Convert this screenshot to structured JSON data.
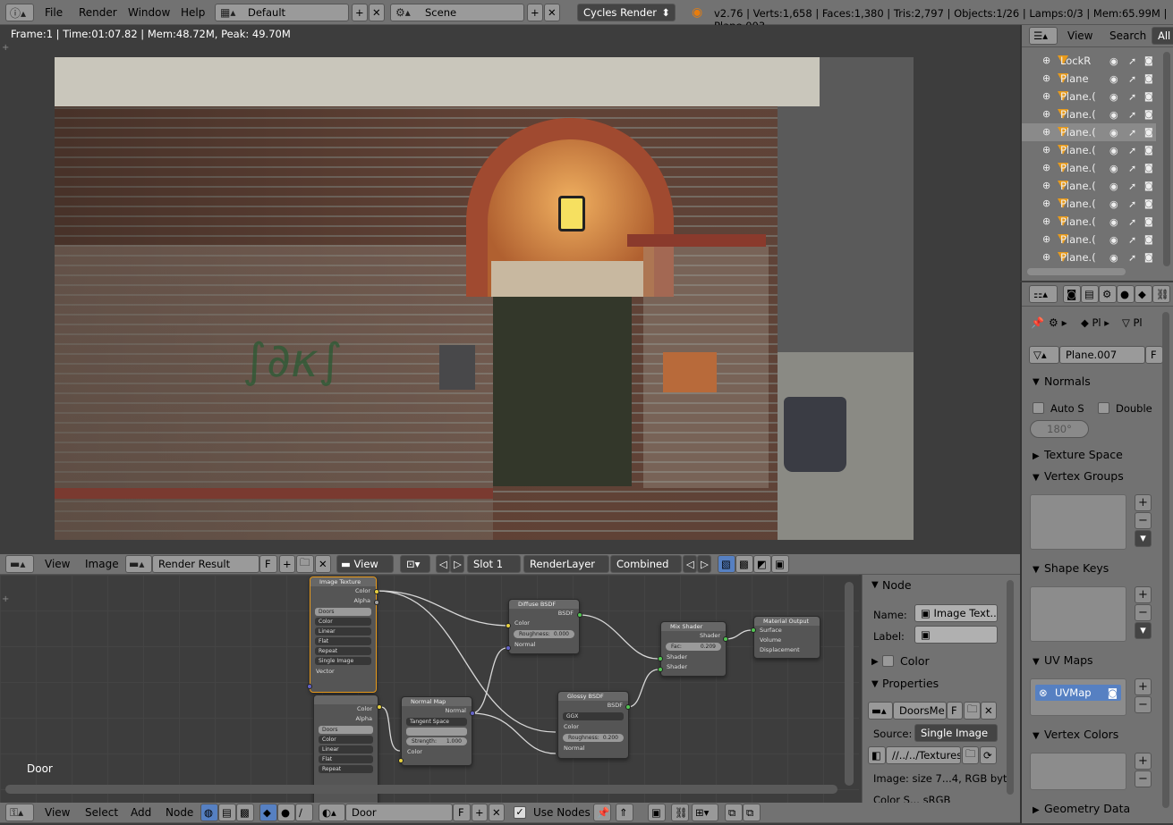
{
  "topbar": {
    "menus": [
      "File",
      "Render",
      "Window",
      "Help"
    ],
    "layout": "Default",
    "scene": "Scene",
    "engine": "Cycles Render",
    "stats": "v2.76 | Verts:1,658 | Faces:1,380 | Tris:2,797 | Objects:1/26 | Lamps:0/3 | Mem:65.99M | Plane.003"
  },
  "render_view": {
    "status": "Frame:1 | Time:01:07.82 | Mem:48.72M, Peak: 49.70M",
    "image_header": {
      "menus": [
        "View",
        "Image"
      ],
      "image_name": "Render Result",
      "f_label": "F",
      "view_label": "View",
      "slot": "Slot 1",
      "layer": "RenderLayer",
      "pass": "Combined"
    }
  },
  "outliner": {
    "header": {
      "view": "View",
      "search": "Search",
      "filter": "All"
    },
    "rows": [
      "LockR",
      "Plane",
      "Plane.(",
      "Plane.(",
      "Plane.(",
      "Plane.(",
      "Plane.(",
      "Plane.(",
      "Plane.(",
      "Plane.(",
      "Plane.(",
      "Plane.("
    ]
  },
  "properties": {
    "breadcrumb": [
      "Pl",
      "Pl"
    ],
    "mesh_name": "Plane.007",
    "f_label": "F",
    "normals": {
      "title": "Normals",
      "auto_smooth": "Auto S",
      "double_sided": "Double",
      "angle": "180°"
    },
    "panels": [
      "Texture Space",
      "Vertex Groups",
      "Shape Keys",
      "UV Maps",
      "Vertex Colors",
      "Geometry Data"
    ],
    "uv_map": "UVMap"
  },
  "node_sidebar": {
    "node_title": "Node",
    "name_label": "Name:",
    "name_value": "Image Text...",
    "label_label": "Label:",
    "color_title": "Color",
    "properties_title": "Properties",
    "image_name": "DoorsMe",
    "f_label": "F",
    "source_label": "Source:",
    "source_value": "Single Image",
    "filepath": "//../../Textures...",
    "image_info": "Image: size 7...4, RGB byte",
    "color_space": "Color S... sRGB"
  },
  "node_editor": {
    "material_label": "Door",
    "header": {
      "menus": [
        "View",
        "Select",
        "Add",
        "Node"
      ],
      "material": "Door",
      "f_label": "F",
      "use_nodes": "Use Nodes"
    },
    "nodes": {
      "image_texture": {
        "title": "Image Texture",
        "outputs": [
          "Color",
          "Alpha"
        ],
        "image": "Doors",
        "dropdowns": [
          "Color",
          "Linear",
          "Flat",
          "Repeat",
          "Single Image"
        ],
        "input": "Vector"
      },
      "image_texture2": {
        "outputs": [
          "Color",
          "Alpha"
        ],
        "image": "Doors",
        "dropdowns": [
          "Color",
          "Linear",
          "Flat",
          "Repeat"
        ]
      },
      "normal_map": {
        "title": "Normal Map",
        "output": "Normal",
        "space": "Tangent Space",
        "uv": "",
        "strength_label": "Strength:",
        "strength": "1.000",
        "input": "Color"
      },
      "diffuse": {
        "title": "Diffuse BSDF",
        "output": "BSDF",
        "inputs": [
          "Color",
          "Normal"
        ],
        "roughness_label": "Roughness:",
        "roughness": "0.000"
      },
      "glossy": {
        "title": "Glossy BSDF",
        "output": "BSDF",
        "distribution": "GGX",
        "inputs": [
          "Color",
          "Normal"
        ],
        "roughness_label": "Roughness:",
        "roughness": "0.200"
      },
      "mix": {
        "title": "Mix Shader",
        "output": "Shader",
        "fac_label": "Fac:",
        "fac": "0.209",
        "inputs": [
          "Shader",
          "Shader"
        ]
      },
      "output": {
        "title": "Material Output",
        "inputs": [
          "Surface",
          "Volume",
          "Displacement"
        ]
      }
    }
  },
  "colors": {
    "header": "#727272",
    "panel": "#727272",
    "viewport": "#3d3d3d",
    "node_bg": "#3d3d3d",
    "selected": "#5680c2"
  }
}
